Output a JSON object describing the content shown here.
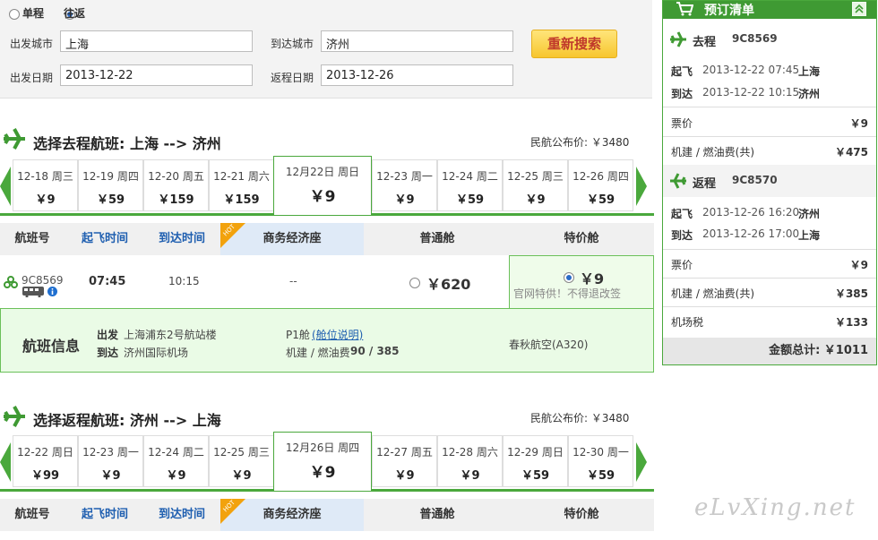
{
  "search": {
    "trip_one_way": "单程",
    "trip_round": "往返",
    "from_label": "出发城市",
    "from_value": "上海",
    "to_label": "到达城市",
    "to_value": "济州",
    "depart_label": "出发日期",
    "depart_value": "2013-12-22",
    "return_label": "返程日期",
    "return_value": "2013-12-26",
    "research_button": "重新搜索"
  },
  "outbound": {
    "title": "选择去程航班: 上海 --> 济州",
    "public_price": "民航公布价: ￥3480",
    "dates": [
      {
        "date": "12-18 周三",
        "price": "￥9"
      },
      {
        "date": "12-19 周四",
        "price": "￥59"
      },
      {
        "date": "12-20 周五",
        "price": "￥159"
      },
      {
        "date": "12-21 周六",
        "price": "￥159"
      },
      {
        "date": "12-23 周一",
        "price": "￥9"
      },
      {
        "date": "12-24 周二",
        "price": "￥59"
      },
      {
        "date": "12-25 周三",
        "price": "￥9"
      },
      {
        "date": "12-26 周四",
        "price": "￥59"
      }
    ],
    "selected_date": "12月22日 周日",
    "selected_price": "￥9",
    "table_headers": [
      "航班号",
      "起飞时间",
      "到达时间",
      "商务经济座",
      "普通舱",
      "特价舱"
    ],
    "hot_badge": "HOT",
    "flight": {
      "number": "9C8569",
      "depart": "07:45",
      "arrive": "10:15",
      "business": "--",
      "economy": "￥620",
      "special_price": "￥9",
      "special_note": "官网特供！不得退改签"
    },
    "info": {
      "title": "航班信息",
      "dep_label": "出发",
      "dep_airport": "上海浦东2号航站楼",
      "arr_label": "到达",
      "arr_airport": "济州国际机场",
      "cabin": "P1舱",
      "cabin_link": "(舱位说明)",
      "tax_label": "机建 / 燃油费",
      "tax_value": "90 / 385",
      "aircraft": "春秋航空(A320)"
    }
  },
  "return": {
    "title": "选择返程航班: 济州 --> 上海",
    "public_price": "民航公布价: ￥3480",
    "dates": [
      {
        "date": "12-22 周日",
        "price": "￥99"
      },
      {
        "date": "12-23 周一",
        "price": "￥9"
      },
      {
        "date": "12-24 周二",
        "price": "￥9"
      },
      {
        "date": "12-25 周三",
        "price": "￥9"
      },
      {
        "date": "12-27 周五",
        "price": "￥9"
      },
      {
        "date": "12-28 周六",
        "price": "￥9"
      },
      {
        "date": "12-29 周日",
        "price": "￥59"
      },
      {
        "date": "12-30 周一",
        "price": "￥59"
      }
    ],
    "selected_date": "12月26日 周四",
    "selected_price": "￥9",
    "table_headers": [
      "航班号",
      "起飞时间",
      "到达时间",
      "商务经济座",
      "普通舱",
      "特价舱"
    ],
    "hot_badge": "HOT"
  },
  "sidebar": {
    "title": "预订清单",
    "outbound_label": "去程",
    "outbound_flight": "9C8569",
    "out_dep_label": "起飞",
    "out_dep": "2013-12-22 07:45",
    "out_dep_city": "上海",
    "out_arr_label": "到达",
    "out_arr": "2013-12-22 10:15",
    "out_arr_city": "济州",
    "out_fare_label": "票价",
    "out_fare": "￥9",
    "out_tax_label": "机建 / 燃油费(共)",
    "out_tax": "￥475",
    "return_label": "返程",
    "return_flight": "9C8570",
    "ret_dep_label": "起飞",
    "ret_dep": "2013-12-26 16:20",
    "ret_dep_city": "济州",
    "ret_arr_label": "到达",
    "ret_arr": "2013-12-26 17:00",
    "ret_arr_city": "上海",
    "ret_fare_label": "票价",
    "ret_fare": "￥9",
    "ret_tax_label": "机建 / 燃油费(共)",
    "ret_tax": "￥385",
    "airport_tax_label": "机场税",
    "airport_tax": "￥133",
    "total": "金额总计: ￥1011"
  },
  "watermark": "eLvXing.net",
  "colors": {
    "green": "#4aa83c",
    "blue": "#1f5fb0",
    "button": "#f7c62f"
  }
}
